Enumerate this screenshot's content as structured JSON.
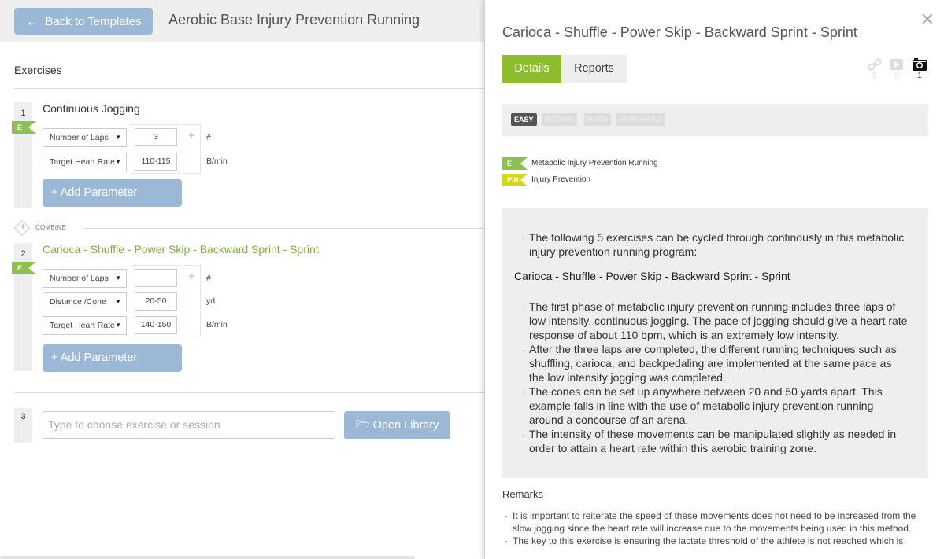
{
  "header": {
    "back_label": "Back to Templates",
    "template_title": "Aerobic Base Injury Prevention Running"
  },
  "exercises_label": "Exercises",
  "exercises": [
    {
      "number": "1",
      "name": "Continuous Jogging",
      "category_flag": "E",
      "params": [
        {
          "name": "Number of Laps",
          "value": "3",
          "unit": "#"
        },
        {
          "name": "Target Heart Rate",
          "value": "110-115",
          "unit": "B/min"
        }
      ],
      "add_param_label": "+ Add Parameter"
    },
    {
      "number": "2",
      "name": "Carioca - Shuffle - Power Skip - Backward Sprint - Sprint",
      "category_flag": "E",
      "params": [
        {
          "name": "Number of Laps",
          "value": "",
          "unit": "#"
        },
        {
          "name": "Distance /Cone",
          "value": "20-50",
          "unit": "yd"
        },
        {
          "name": "Target Heart Rate",
          "value": "140-150",
          "unit": "B/min"
        }
      ],
      "add_param_label": "+ Add Parameter"
    }
  ],
  "combine_label": "COMBINE",
  "new_exercise": {
    "number": "3",
    "placeholder": "Type to choose exercise or session",
    "open_library_label": "Open Library"
  },
  "detail": {
    "title": "Carioca - Shuffle - Power Skip - Backward Sprint - Sprint",
    "tabs": [
      {
        "label": "Details",
        "active": true
      },
      {
        "label": "Reports",
        "active": false
      }
    ],
    "media": [
      {
        "icon": "link-icon",
        "count": "0"
      },
      {
        "icon": "video-icon",
        "count": "0"
      },
      {
        "icon": "camera-icon",
        "count": "1"
      }
    ],
    "difficulty": {
      "levels": [
        "EASY",
        "MEDIUM",
        "HARD",
        "VERY HARD"
      ],
      "selected": "EASY"
    },
    "tags": [
      {
        "flag": "E",
        "label": "Metabolic Injury Prevention Running",
        "color": "#8cc152"
      },
      {
        "flag": "P/R",
        "label": "Injury Prevention",
        "color": "#d4d41a"
      }
    ],
    "description": {
      "intro": "The following 5 exercises can be cycled through continously in this metabolic injury prevention running program:",
      "sequence": "Carioca - Shuffle - Power Skip - Backward Sprint - Sprint",
      "points": [
        "The first phase of metabolic injury prevention running includes three laps of low intensity, continuous jogging. The pace of jogging should give a heart rate response of about 110 bpm, which is an extremely low intensity.",
        "After the three laps are completed, the different running techniques such as shuffling, carioca, and backpedaling are implemented at the same pace as the low intensity jogging was completed.",
        "The cones can be set up anywhere between 20 and 50 yards apart. This example falls in line with the use of metabolic injury prevention running around a concourse of an arena.",
        "The intensity of these movements can be manipulated slightly as needed in order to attain a heart rate within this aerobic training zone."
      ]
    },
    "remarks_heading": "Remarks",
    "remarks": [
      "It is important to reiterate the speed of these movements does not need to be increased from the slow jogging since the heart rate will increase due to the movements being used in this method.",
      "The key to this exercise is ensuring the lactate threshold of the athlete is not reached which is"
    ]
  },
  "colors": {
    "accent_green": "#8bbd2d",
    "button_blue": "#9bb9d6",
    "flag_green": "#8cc152",
    "flag_yellow": "#d4d41a"
  }
}
